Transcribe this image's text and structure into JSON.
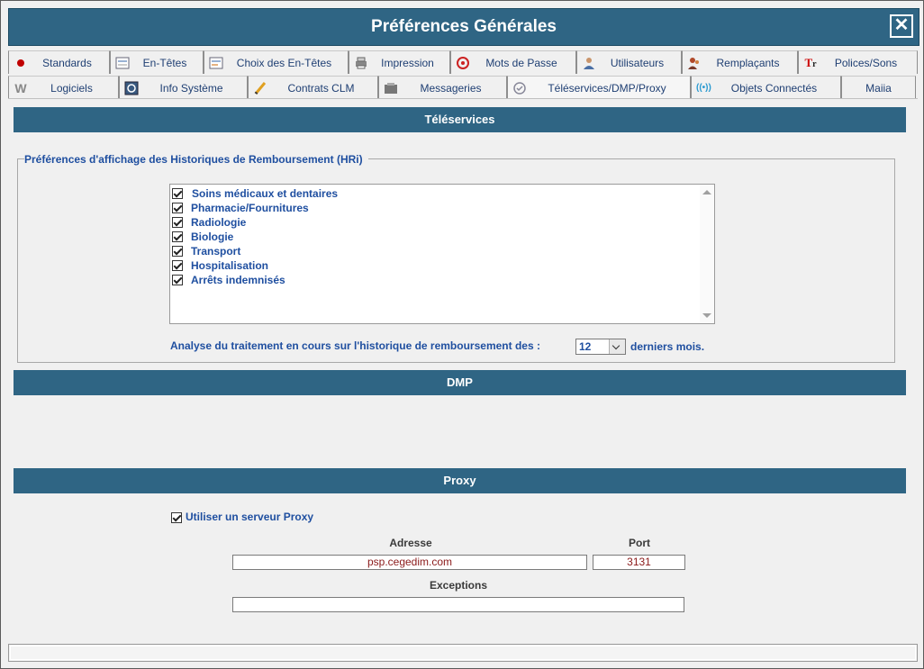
{
  "window": {
    "title": "Préférences Générales"
  },
  "tabs_row1": [
    {
      "label": "Standards",
      "icon": "red-dot-icon"
    },
    {
      "label": "En-Têtes",
      "icon": "header-icon"
    },
    {
      "label": "Choix des En-Têtes",
      "icon": "header-choice-icon"
    },
    {
      "label": "Impression",
      "icon": "printer-icon"
    },
    {
      "label": "Mots de Passe",
      "icon": "password-icon"
    },
    {
      "label": "Utilisateurs",
      "icon": "user-icon"
    },
    {
      "label": "Remplaçants",
      "icon": "substitute-icon"
    },
    {
      "label": "Polices/Sons",
      "icon": "font-icon"
    }
  ],
  "tabs_row2": [
    {
      "label": "Logiciels",
      "icon": "software-icon"
    },
    {
      "label": "Info Système",
      "icon": "system-info-icon"
    },
    {
      "label": "Contrats CLM",
      "icon": "pencil-icon"
    },
    {
      "label": "Messageries",
      "icon": "mail-icon"
    },
    {
      "label": "Téléservices/DMP/Proxy",
      "icon": "teleservices-icon",
      "active": true
    },
    {
      "label": "Objets Connectés",
      "icon": "wireless-icon"
    },
    {
      "label": "Maiia",
      "icon": ""
    }
  ],
  "teleservices": {
    "header": "Téléservices",
    "legend": "Préférences d'affichage des Historiques de Remboursement  (HRi)",
    "items": [
      {
        "label": "Soins médicaux et dentaires",
        "checked": true
      },
      {
        "label": "Pharmacie/Fournitures",
        "checked": true
      },
      {
        "label": "Radiologie",
        "checked": true
      },
      {
        "label": "Biologie",
        "checked": true
      },
      {
        "label": "Transport",
        "checked": true
      },
      {
        "label": "Hospitalisation",
        "checked": true
      },
      {
        "label": "Arrêts indemnisés",
        "checked": true
      }
    ],
    "analyse_label": "Analyse du traitement en cours sur l'historique de remboursement des :",
    "months_value": "12",
    "months_suffix": "derniers mois."
  },
  "dmp": {
    "header": "DMP"
  },
  "proxy": {
    "header": "Proxy",
    "use_proxy_label": "Utiliser un serveur Proxy",
    "use_proxy_checked": true,
    "address_label": "Adresse",
    "address_value": "psp.cegedim.com",
    "port_label": "Port",
    "port_value": "3131",
    "exceptions_label": "Exceptions",
    "exceptions_value": ""
  }
}
